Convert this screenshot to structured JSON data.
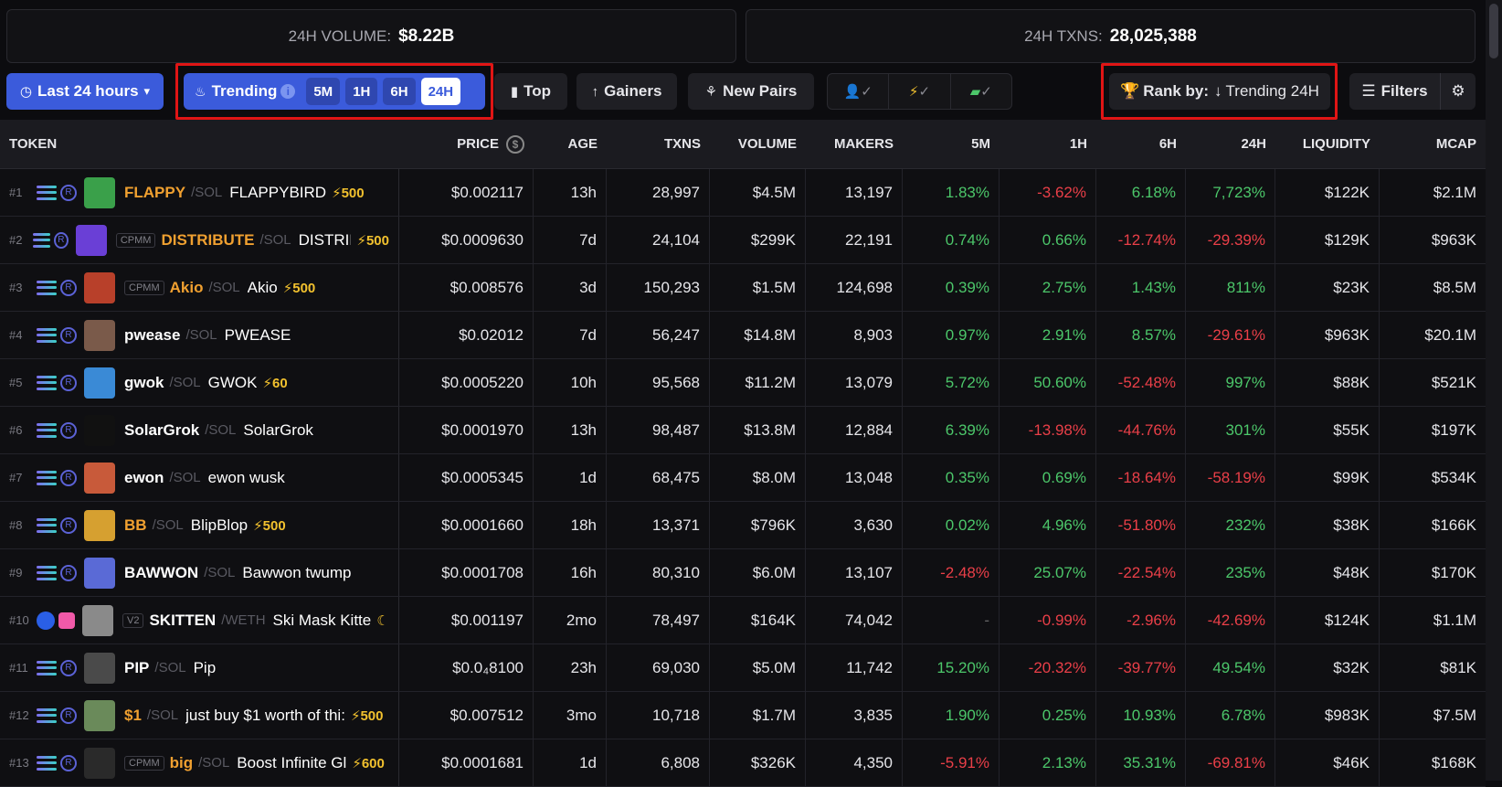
{
  "stats": {
    "volume_label": "24H VOLUME:",
    "volume_value": "$8.22B",
    "txns_label": "24H TXNS:",
    "txns_value": "28,025,388"
  },
  "toolbar": {
    "timerange": "Last 24 hours",
    "trending": "Trending",
    "timeframes": [
      "5M",
      "1H",
      "6H",
      "24H"
    ],
    "active_timeframe": "24H",
    "top": "Top",
    "gainers": "Gainers",
    "new_pairs": "New Pairs",
    "rank_label": "Rank by:",
    "rank_value": "Trending 24H",
    "filters": "Filters"
  },
  "columns": [
    "TOKEN",
    "PRICE",
    "AGE",
    "TXNS",
    "VOLUME",
    "MAKERS",
    "5M",
    "1H",
    "6H",
    "24H",
    "LIQUIDITY",
    "MCAP"
  ],
  "rows": [
    {
      "rank": "#1",
      "chain": "sol",
      "dex": "r",
      "avatar_color": "#3aa04a",
      "tag": "",
      "symbol": "FLAPPY",
      "symbol_color": "orange",
      "quote": "/SOL",
      "name": "FLAPPYBIRD",
      "boost": "⚡500",
      "price": "$0.002117",
      "age": "13h",
      "txns": "28,997",
      "volume": "$4.5M",
      "makers": "13,197",
      "m5": "1.83%",
      "h1": "-3.62%",
      "h6": "6.18%",
      "h24": "7,723%",
      "liquidity": "$122K",
      "mcap": "$2.1M"
    },
    {
      "rank": "#2",
      "chain": "sol",
      "dex": "r",
      "avatar_color": "#6a3fd6",
      "tag": "CPMM",
      "symbol": "DISTRIBUTE",
      "symbol_color": "orange",
      "quote": "/SOL",
      "name": "DISTRIE",
      "boost": "⚡500",
      "price": "$0.0009630",
      "age": "7d",
      "txns": "24,104",
      "volume": "$299K",
      "makers": "22,191",
      "m5": "0.74%",
      "h1": "0.66%",
      "h6": "-12.74%",
      "h24": "-29.39%",
      "liquidity": "$129K",
      "mcap": "$963K"
    },
    {
      "rank": "#3",
      "chain": "sol",
      "dex": "r",
      "avatar_color": "#b8402a",
      "tag": "CPMM",
      "symbol": "Akio",
      "symbol_color": "orange",
      "quote": "/SOL",
      "name": "Akio",
      "boost": "⚡500",
      "price": "$0.008576",
      "age": "3d",
      "txns": "150,293",
      "volume": "$1.5M",
      "makers": "124,698",
      "m5": "0.39%",
      "h1": "2.75%",
      "h6": "1.43%",
      "h24": "811%",
      "liquidity": "$23K",
      "mcap": "$8.5M"
    },
    {
      "rank": "#4",
      "chain": "sol",
      "dex": "r",
      "avatar_color": "#7a5a4a",
      "tag": "",
      "symbol": "pwease",
      "symbol_color": "white",
      "quote": "/SOL",
      "name": "PWEASE",
      "boost": "",
      "price": "$0.02012",
      "age": "7d",
      "txns": "56,247",
      "volume": "$14.8M",
      "makers": "8,903",
      "m5": "0.97%",
      "h1": "2.91%",
      "h6": "8.57%",
      "h24": "-29.61%",
      "liquidity": "$963K",
      "mcap": "$20.1M"
    },
    {
      "rank": "#5",
      "chain": "sol",
      "dex": "r",
      "avatar_color": "#3a8ad6",
      "tag": "",
      "symbol": "gwok",
      "symbol_color": "white",
      "quote": "/SOL",
      "name": "GWOK",
      "boost": "⚡60",
      "price": "$0.0005220",
      "age": "10h",
      "txns": "95,568",
      "volume": "$11.2M",
      "makers": "13,079",
      "m5": "5.72%",
      "h1": "50.60%",
      "h6": "-52.48%",
      "h24": "997%",
      "liquidity": "$88K",
      "mcap": "$521K"
    },
    {
      "rank": "#6",
      "chain": "sol",
      "dex": "r",
      "avatar_color": "#111111",
      "tag": "",
      "symbol": "SolarGrok",
      "symbol_color": "white",
      "quote": "/SOL",
      "name": "SolarGrok",
      "boost": "",
      "price": "$0.0001970",
      "age": "13h",
      "txns": "98,487",
      "volume": "$13.8M",
      "makers": "12,884",
      "m5": "6.39%",
      "h1": "-13.98%",
      "h6": "-44.76%",
      "h24": "301%",
      "liquidity": "$55K",
      "mcap": "$197K"
    },
    {
      "rank": "#7",
      "chain": "sol",
      "dex": "r",
      "avatar_color": "#c85a3a",
      "tag": "",
      "symbol": "ewon",
      "symbol_color": "white",
      "quote": "/SOL",
      "name": "ewon wusk",
      "boost": "",
      "price": "$0.0005345",
      "age": "1d",
      "txns": "68,475",
      "volume": "$8.0M",
      "makers": "13,048",
      "m5": "0.35%",
      "h1": "0.69%",
      "h6": "-18.64%",
      "h24": "-58.19%",
      "liquidity": "$99K",
      "mcap": "$534K"
    },
    {
      "rank": "#8",
      "chain": "sol",
      "dex": "r",
      "avatar_color": "#d6a030",
      "tag": "",
      "symbol": "BB",
      "symbol_color": "orange",
      "quote": "/SOL",
      "name": "BlipBlop",
      "boost": "⚡500",
      "price": "$0.0001660",
      "age": "18h",
      "txns": "13,371",
      "volume": "$796K",
      "makers": "3,630",
      "m5": "0.02%",
      "h1": "4.96%",
      "h6": "-51.80%",
      "h24": "232%",
      "liquidity": "$38K",
      "mcap": "$166K"
    },
    {
      "rank": "#9",
      "chain": "sol",
      "dex": "r",
      "avatar_color": "#5a6ad6",
      "tag": "",
      "symbol": "BAWWON",
      "symbol_color": "white",
      "quote": "/SOL",
      "name": "Bawwon twump",
      "boost": "",
      "price": "$0.0001708",
      "age": "16h",
      "txns": "80,310",
      "volume": "$6.0M",
      "makers": "13,107",
      "m5": "-2.48%",
      "h1": "25.07%",
      "h6": "-22.54%",
      "h24": "235%",
      "liquidity": "$48K",
      "mcap": "$170K"
    },
    {
      "rank": "#10",
      "chain": "eth",
      "dex": "pink",
      "avatar_color": "#8a8a8a",
      "tag": "V2",
      "symbol": "SKITTEN",
      "symbol_color": "white",
      "quote": "/WETH",
      "name": "Ski Mask Kitte",
      "boost": "☾",
      "price": "$0.001197",
      "age": "2mo",
      "txns": "78,497",
      "volume": "$164K",
      "makers": "74,042",
      "m5": "-",
      "h1": "-0.99%",
      "h6": "-2.96%",
      "h24": "-42.69%",
      "liquidity": "$124K",
      "mcap": "$1.1M"
    },
    {
      "rank": "#11",
      "chain": "sol",
      "dex": "r",
      "avatar_color": "#4a4a4a",
      "tag": "",
      "symbol": "PIP",
      "symbol_color": "white",
      "quote": "/SOL",
      "name": "Pip",
      "boost": "",
      "price": "$0.0₄8100",
      "age": "23h",
      "txns": "69,030",
      "volume": "$5.0M",
      "makers": "11,742",
      "m5": "15.20%",
      "h1": "-20.32%",
      "h6": "-39.77%",
      "h24": "49.54%",
      "liquidity": "$32K",
      "mcap": "$81K"
    },
    {
      "rank": "#12",
      "chain": "sol",
      "dex": "r",
      "avatar_color": "#6a8a5a",
      "tag": "",
      "symbol": "$1",
      "symbol_color": "orange",
      "quote": "/SOL",
      "name": "just buy $1 worth of thi:",
      "boost": "⚡500",
      "price": "$0.007512",
      "age": "3mo",
      "txns": "10,718",
      "volume": "$1.7M",
      "makers": "3,835",
      "m5": "1.90%",
      "h1": "0.25%",
      "h6": "10.93%",
      "h24": "6.78%",
      "liquidity": "$983K",
      "mcap": "$7.5M"
    },
    {
      "rank": "#13",
      "chain": "sol",
      "dex": "r",
      "avatar_color": "#2a2a2a",
      "tag": "CPMM",
      "symbol": "big",
      "symbol_color": "orange",
      "quote": "/SOL",
      "name": "Boost Infinite Gl",
      "boost": "⚡600",
      "price": "$0.0001681",
      "age": "1d",
      "txns": "6,808",
      "volume": "$326K",
      "makers": "4,350",
      "m5": "-5.91%",
      "h1": "2.13%",
      "h6": "35.31%",
      "h24": "-69.81%",
      "liquidity": "$46K",
      "mcap": "$168K"
    }
  ]
}
